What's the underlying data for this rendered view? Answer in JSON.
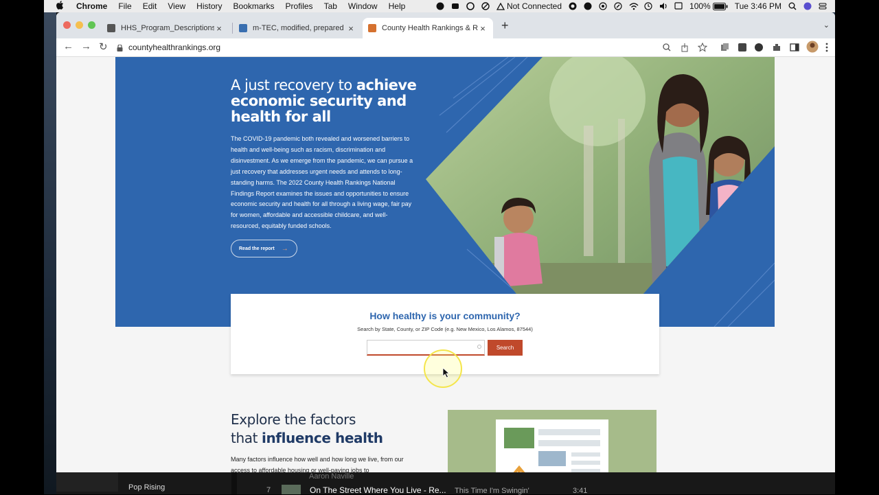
{
  "menubar": {
    "apple": "",
    "app": "Chrome",
    "items": [
      "File",
      "Edit",
      "View",
      "History",
      "Bookmarks",
      "Profiles",
      "Tab",
      "Window",
      "Help"
    ],
    "status": {
      "network": "Not Connected",
      "battery": "100%",
      "clock": "Tue 3:46 PM"
    }
  },
  "browser": {
    "tabs": [
      {
        "title": "HHS_Program_Descriptions.pd",
        "close": "×"
      },
      {
        "title": "m-TEC, modified, prepared ag",
        "close": "×"
      },
      {
        "title": "County Health Rankings & Roa",
        "close": "×"
      }
    ],
    "new_tab": "+",
    "url": "countyhealthrankings.org"
  },
  "hero": {
    "title_light": "A just recovery to ",
    "title_bold": "achieve economic security and health for all",
    "body": "The COVID-19 pandemic both revealed and worsened barriers to health and well-being such as racism, discrimination and disinvestment. As we emerge from the pandemic, we can pursue a just recovery that addresses urgent needs and attends to long-standing harms. The 2022 County Health Rankings National Findings Report examines the issues and opportunities to ensure economic security and health for all through a living wage, fair pay for women, affordable and accessible childcare, and well-resourced, equitably funded schools.",
    "button": "Read the report",
    "button_arrow": "→"
  },
  "search": {
    "title": "How healthy is your community?",
    "subtitle": "Search by State, County, or ZIP Code (e.g. New Mexico, Los Alamos, 87544)",
    "input_value": "",
    "button": "Search"
  },
  "explore": {
    "title_light_1": "Explore the factors",
    "title_light_2": "that ",
    "title_bold": "influence health",
    "body": "Many factors influence how well and how long we live, from our access to affordable housing or well-paying jobs to"
  },
  "music": {
    "playlist": "Pop Rising",
    "faded_text": "Aaron Naville",
    "track_number": "7",
    "track_title": "On The Street Where You Live - Re...",
    "album": "This Time I'm Swingin'",
    "duration": "3:41"
  },
  "colors": {
    "hero_blue": "#2e66ae",
    "accent_orange": "#c0492b",
    "heading_navy": "#1f3a66",
    "explore_green": "#a6bb8a"
  }
}
